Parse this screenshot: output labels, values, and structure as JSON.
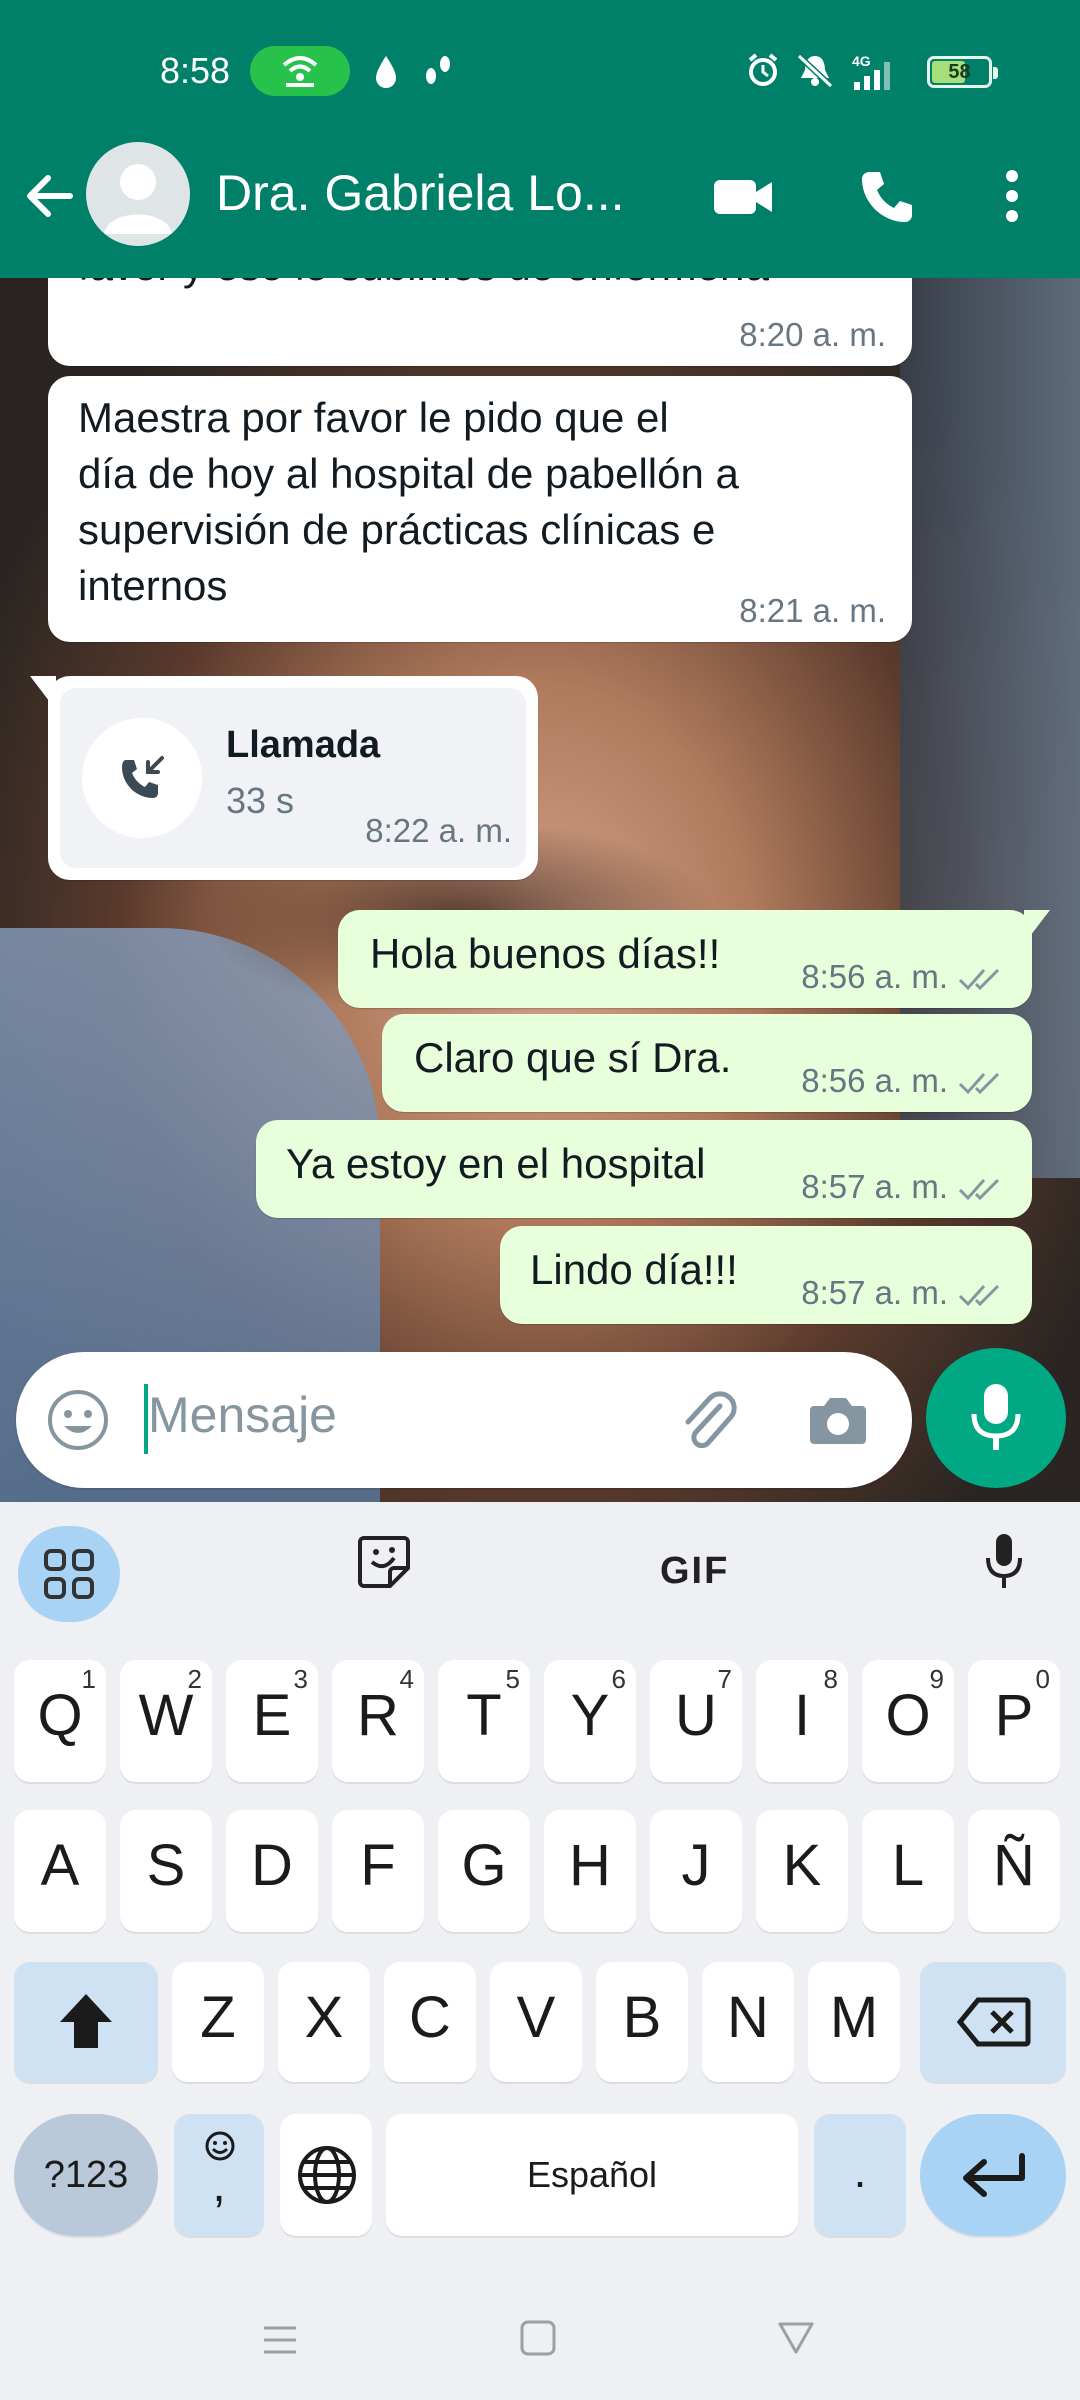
{
  "status_bar": {
    "time": "8:58",
    "battery": "58",
    "network": "4G"
  },
  "header": {
    "contact_name": "Dra. Gabriela Lo...",
    "icons": [
      "back-arrow-icon",
      "video-call-icon",
      "voice-call-icon",
      "more-options-icon"
    ]
  },
  "messages": [
    {
      "direction": "in",
      "text": "favor y eso le subimos de enfermería",
      "time": "8:20 a. m."
    },
    {
      "direction": "in",
      "text": "Maestra por favor le pido que el día de hoy al hospital de pabellón a supervisión de prácticas clínicas e internos",
      "lines": [
        "Maestra por favor le pido que el",
        "día de hoy al hospital de pabellón a",
        "supervisión de prácticas clínicas e",
        "internos"
      ],
      "time": "8:21 a. m."
    },
    {
      "direction": "in",
      "type": "call",
      "title": "Llamada",
      "duration": "33 s",
      "time": "8:22 a. m."
    },
    {
      "direction": "out",
      "text": "Hola buenos días!!",
      "time": "8:56 a. m."
    },
    {
      "direction": "out",
      "text": "Claro que sí Dra.",
      "time": "8:56 a. m."
    },
    {
      "direction": "out",
      "text": "Ya estoy en el hospital",
      "time": "8:57 a. m."
    },
    {
      "direction": "out",
      "text": "Lindo día!!!",
      "time": "8:57 a. m."
    }
  ],
  "composer": {
    "placeholder": "Mensaje"
  },
  "keyboard": {
    "toolbar_gif": "GIF",
    "row1": [
      {
        "k": "Q",
        "n": "1"
      },
      {
        "k": "W",
        "n": "2"
      },
      {
        "k": "E",
        "n": "3"
      },
      {
        "k": "R",
        "n": "4"
      },
      {
        "k": "T",
        "n": "5"
      },
      {
        "k": "Y",
        "n": "6"
      },
      {
        "k": "U",
        "n": "7"
      },
      {
        "k": "I",
        "n": "8"
      },
      {
        "k": "O",
        "n": "9"
      },
      {
        "k": "P",
        "n": "0"
      }
    ],
    "row2": [
      "A",
      "S",
      "D",
      "F",
      "G",
      "H",
      "J",
      "K",
      "L",
      "Ñ"
    ],
    "row3": [
      "Z",
      "X",
      "C",
      "V",
      "B",
      "N",
      "M"
    ],
    "symbols_key": "?123",
    "emoji_comma_key": ",",
    "space_label": "Español",
    "period_key": "."
  },
  "colors": {
    "brand": "#008069",
    "accent": "#00a884",
    "outgoing_bubble": "#e7ffdb",
    "read_ticks": "#8696a0"
  }
}
